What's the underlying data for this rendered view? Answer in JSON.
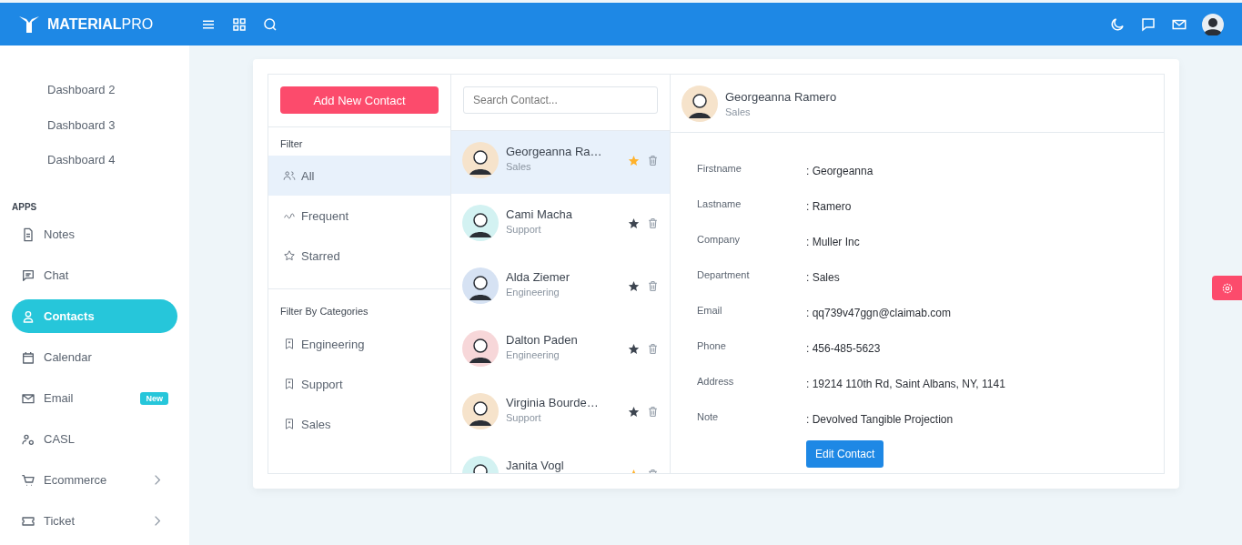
{
  "topbar": {
    "brand_bold": "MATERIAL",
    "brand_light": "PRO"
  },
  "sidebar": {
    "items": [
      {
        "kind": "sublink",
        "label": "Dashboard 2",
        "selected": false
      },
      {
        "kind": "sublink",
        "label": "Dashboard 3",
        "selected": false
      },
      {
        "kind": "sublink",
        "label": "Dashboard 4",
        "selected": false
      },
      {
        "kind": "header",
        "label": "APPS"
      },
      {
        "kind": "link",
        "label": "Notes",
        "selected": false
      },
      {
        "kind": "link",
        "label": "Chat",
        "selected": false
      },
      {
        "kind": "link",
        "label": "Contacts",
        "selected": true
      },
      {
        "kind": "link",
        "label": "Calendar",
        "selected": false
      },
      {
        "kind": "link",
        "label": "Email",
        "selected": false,
        "badge": "New"
      },
      {
        "kind": "link",
        "label": "CASL",
        "selected": false
      },
      {
        "kind": "link",
        "label": "Ecommerce",
        "selected": false,
        "expandable": true
      },
      {
        "kind": "link",
        "label": "Ticket",
        "selected": false,
        "expandable": true
      }
    ]
  },
  "filters": {
    "add_button": "Add New Contact",
    "title": "Filter",
    "items": [
      {
        "label": "All",
        "selected": true
      },
      {
        "label": "Frequent",
        "selected": false
      },
      {
        "label": "Starred",
        "selected": false
      }
    ],
    "categories_title": "Filter By Categories",
    "categories": [
      {
        "label": "Engineering"
      },
      {
        "label": "Support"
      },
      {
        "label": "Sales"
      }
    ]
  },
  "contacts": {
    "search": {
      "placeholder": "Search Contact..."
    },
    "items": [
      {
        "name": "Georgeanna Ra…",
        "department": "Sales",
        "starred": true,
        "selected": true,
        "color": "#f6e3cb"
      },
      {
        "name": "Cami Macha",
        "department": "Support",
        "starred": false,
        "selected": false,
        "color": "#d3f2f2"
      },
      {
        "name": "Alda Ziemer",
        "department": "Engineering",
        "starred": false,
        "selected": false,
        "color": "#d6e2f3"
      },
      {
        "name": "Dalton Paden",
        "department": "Engineering",
        "starred": false,
        "selected": false,
        "color": "#f7d7d9"
      },
      {
        "name": "Virginia Bourde…",
        "department": "Support",
        "starred": false,
        "selected": false,
        "color": "#f6e3cb"
      },
      {
        "name": "Janita Vogl",
        "starred": true,
        "selected": false,
        "color": "#d3f2f2"
      }
    ]
  },
  "detail": {
    "name": "Georgeanna Ramero",
    "department": "Sales",
    "fields": [
      {
        "label": "Firstname",
        "value": ": Georgeanna"
      },
      {
        "label": "Lastname",
        "value": ": Ramero"
      },
      {
        "label": "Company",
        "value": ": Muller Inc"
      },
      {
        "label": "Department",
        "value": ": Sales"
      },
      {
        "label": "Email",
        "value": ": qq739v47ggn@claimab.com"
      },
      {
        "label": "Phone",
        "value": ": 456-485-5623"
      },
      {
        "label": "Address",
        "value": ": 19214 110th Rd, Saint Albans, NY, 1141"
      },
      {
        "label": "Note",
        "value": ": Devolved Tangible Projection"
      }
    ],
    "edit_button": "Edit Contact"
  }
}
